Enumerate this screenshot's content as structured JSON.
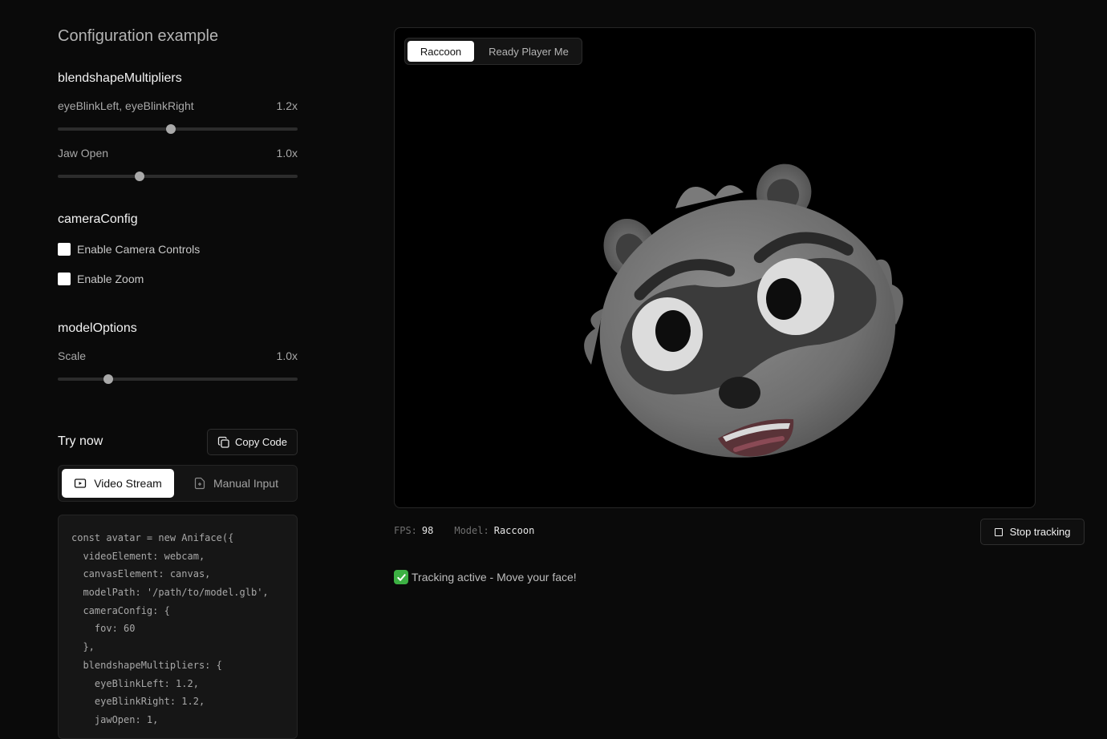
{
  "config": {
    "title": "Configuration example",
    "blendshape": {
      "title": "blendshapeMultipliers",
      "sliders": [
        {
          "label": "eyeBlinkLeft, eyeBlinkRight",
          "value": "1.2x",
          "fraction": 0.47
        },
        {
          "label": "Jaw Open",
          "value": "1.0x",
          "fraction": 0.34
        }
      ]
    },
    "camera": {
      "title": "cameraConfig",
      "options": [
        {
          "label": "Enable Camera Controls",
          "checked": false
        },
        {
          "label": "Enable Zoom",
          "checked": false
        }
      ]
    },
    "model": {
      "title": "modelOptions",
      "sliders": [
        {
          "label": "Scale",
          "value": "1.0x",
          "fraction": 0.21
        }
      ]
    }
  },
  "try_now": {
    "title": "Try now",
    "copy_label": "Copy Code",
    "tabs": [
      {
        "label": "Video Stream",
        "active": true,
        "icon": "video-icon"
      },
      {
        "label": "Manual Input",
        "active": false,
        "icon": "file-plus-icon"
      }
    ],
    "code_lines": [
      "const avatar = new Aniface({",
      "  videoElement: webcam,",
      "  canvasElement: canvas,",
      "  modelPath: '/path/to/model.glb',",
      "  cameraConfig: {",
      "    fov: 60",
      "  },",
      "  blendshapeMultipliers: {",
      "    eyeBlinkLeft: 1.2,",
      "    eyeBlinkRight: 1.2,",
      "    jawOpen: 1,"
    ]
  },
  "viewer": {
    "model_tabs": [
      {
        "label": "Raccoon",
        "active": true
      },
      {
        "label": "Ready Player Me",
        "active": false
      }
    ],
    "avatar_icon": "raccoon-avatar"
  },
  "stats": {
    "fps_label": "FPS:",
    "fps_value": "98",
    "model_label": "Model:",
    "model_value": "Raccoon"
  },
  "stop_label": "Stop tracking",
  "status_text": "Tracking active - Move your face!",
  "colors": {
    "background": "#0a0a0a",
    "status_check": "#3cb043"
  }
}
